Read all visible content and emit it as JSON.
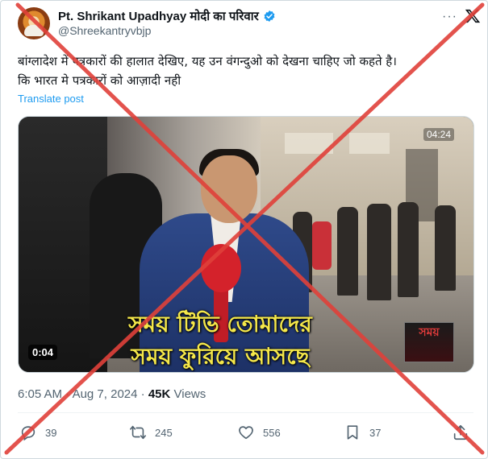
{
  "author": {
    "display_name": "Pt. Shrikant Upadhyay मोदी का परिवार",
    "handle": "@Shreekantryvbjp",
    "avatar_icon": "avatar-image",
    "verified_icon": "verified-badge-icon",
    "verified_color": "#1d9bf0"
  },
  "header": {
    "more_icon": "more-options-icon",
    "more_label": "···",
    "logo_icon": "x-logo-icon"
  },
  "post": {
    "text_line1": "बांग्लादेश में पत्रकारों की हालात देखिए, यह उन वंगन्दुओ को देखना चाहिए जो कहते है।",
    "text_line2": "कि भारत मे पत्रकारों को आज़ादी नही",
    "translate_label": "Translate post"
  },
  "video": {
    "caption_line1": "সময় টিভি তোমাদের",
    "caption_line2": "সময় ফুরিয়ে আসছে",
    "corner_time": "04:24",
    "channel_logo_text": "সময়",
    "duration": "0:04"
  },
  "meta": {
    "time": "6:05 AM",
    "separator": "·",
    "date": "Aug 7, 2024",
    "views_count": "45K",
    "views_label": "Views"
  },
  "actions": {
    "reply_count": "39",
    "repost_count": "245",
    "like_count": "556",
    "bookmark_count": "37",
    "reply_icon": "reply-icon",
    "repost_icon": "repost-icon",
    "like_icon": "heart-icon",
    "bookmark_icon": "bookmark-icon",
    "share_icon": "share-icon"
  },
  "overlay": {
    "stamp_icon": "false-claim-cross-icon",
    "stamp_color": "#e0413a"
  }
}
